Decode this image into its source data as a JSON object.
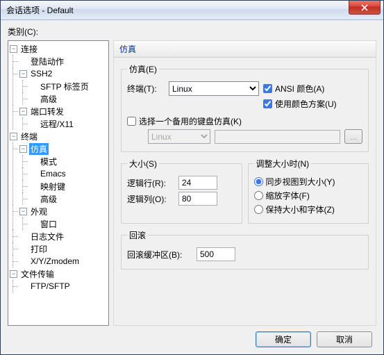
{
  "window": {
    "title": "会话选项 - Default"
  },
  "category_label": "类别(C):",
  "tree": {
    "connection": "连接",
    "login_action": "登陆动作",
    "ssh2": "SSH2",
    "sftp_tab": "SFTP 标签页",
    "advanced1": "高级",
    "port_forward": "端口转发",
    "remote_x11": "远程/X11",
    "terminal": "终端",
    "emulation": "仿真",
    "mode": "模式",
    "emacs": "Emacs",
    "map_keys": "映射键",
    "advanced2": "高级",
    "appearance": "外观",
    "window": "窗口",
    "log_file": "日志文件",
    "print": "打印",
    "xyz": "X/Y/Zmodem",
    "file_transfer": "文件传输",
    "ftp_sftp": "FTP/SFTP"
  },
  "panel": {
    "title": "仿真",
    "emulation_group": "仿真(E)",
    "terminal_label": "终端(T):",
    "terminal_value": "Linux",
    "ansi_color": "ANSI 颜色(A)",
    "use_color_scheme": "使用颜色方案(U)",
    "alt_keyboard": "选择一个备用的键盘仿真(K)",
    "alt_combo": "Linux",
    "browse": "...",
    "size_group": "大小(S)",
    "rows_label": "逻辑行(R):",
    "rows_value": "24",
    "cols_label": "逻辑列(O):",
    "cols_value": "80",
    "resize_group": "调整大小时(N)",
    "resize_sync": "同步视图到大小(Y)",
    "resize_scale": "缩放字体(F)",
    "resize_keep": "保持大小和字体(Z)",
    "scrollback_group": "回滚",
    "scrollback_label": "回滚缓冲区(B):",
    "scrollback_value": "500"
  },
  "buttons": {
    "ok": "确定",
    "cancel": "取消"
  }
}
